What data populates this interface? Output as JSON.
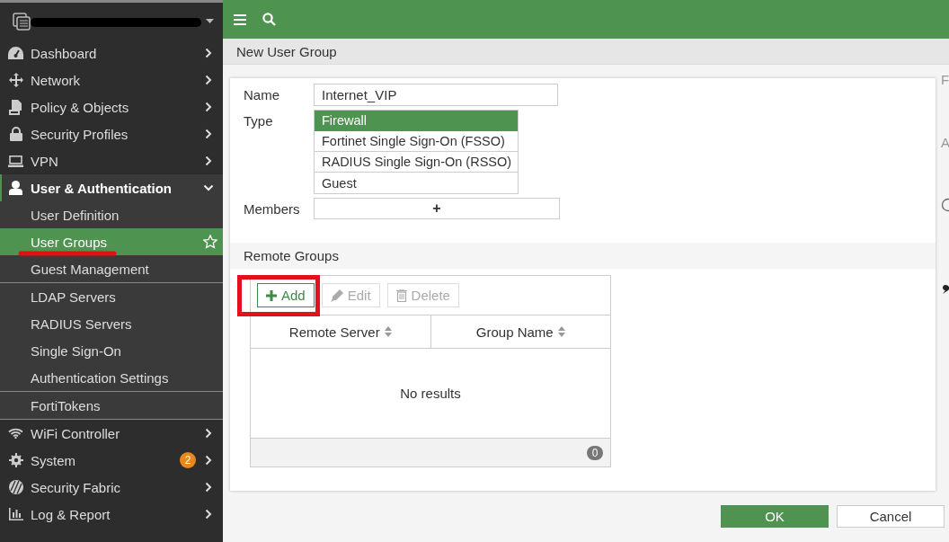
{
  "sidebar": {
    "items": [
      {
        "label": "Dashboard",
        "expanded": false
      },
      {
        "label": "Network",
        "expanded": false
      },
      {
        "label": "Policy & Objects",
        "expanded": false
      },
      {
        "label": "Security Profiles",
        "expanded": false
      },
      {
        "label": "VPN",
        "expanded": false
      },
      {
        "label": "User & Authentication",
        "expanded": true,
        "groups": [
          {
            "items": [
              {
                "label": "User Definition",
                "selected": false
              },
              {
                "label": "User Groups",
                "selected": true
              },
              {
                "label": "Guest Management",
                "selected": false
              }
            ]
          },
          {
            "items": [
              {
                "label": "LDAP Servers",
                "selected": false
              },
              {
                "label": "RADIUS Servers",
                "selected": false
              },
              {
                "label": "Single Sign-On",
                "selected": false
              },
              {
                "label": "Authentication Settings",
                "selected": false
              }
            ]
          },
          {
            "items": [
              {
                "label": "FortiTokens",
                "selected": false
              }
            ]
          }
        ]
      },
      {
        "label": "WiFi Controller",
        "expanded": false
      },
      {
        "label": "System",
        "expanded": false,
        "badge": "2"
      },
      {
        "label": "Security Fabric",
        "expanded": false
      },
      {
        "label": "Log & Report",
        "expanded": false
      }
    ]
  },
  "page": {
    "title": "New User Group"
  },
  "form": {
    "name_label": "Name",
    "name_value": "Internet_VIP",
    "type_label": "Type",
    "types": [
      {
        "label": "Firewall",
        "selected": true
      },
      {
        "label": "Fortinet Single Sign-On (FSSO)",
        "selected": false
      },
      {
        "label": "RADIUS Single Sign-On (RSSO)",
        "selected": false
      },
      {
        "label": "Guest",
        "selected": false
      }
    ],
    "members_label": "Members",
    "members_add": "+"
  },
  "remote_groups": {
    "title": "Remote Groups",
    "toolbar": [
      {
        "label": "Add",
        "kind": "add",
        "disabled": false
      },
      {
        "label": "Edit",
        "kind": "edit",
        "disabled": true
      },
      {
        "label": "Delete",
        "kind": "delete",
        "disabled": true
      }
    ],
    "columns": [
      "Remote Server",
      "Group Name"
    ],
    "empty": "No results",
    "count": "0"
  },
  "side_panel": {
    "texts": [
      "F",
      "A"
    ]
  },
  "buttons": [
    {
      "label": "OK",
      "kind": "primary"
    },
    {
      "label": "Cancel",
      "kind": "secondary"
    }
  ]
}
